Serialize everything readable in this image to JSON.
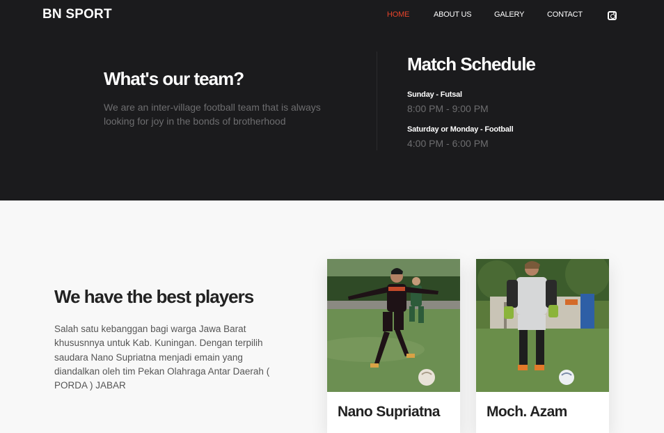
{
  "brand": "BN SPORT",
  "nav": {
    "items": [
      {
        "label": "HOME",
        "active": true
      },
      {
        "label": "ABOUT US",
        "active": false
      },
      {
        "label": "GALERY",
        "active": false
      },
      {
        "label": "CONTACT",
        "active": false
      }
    ],
    "social_icon": "instagram-icon"
  },
  "team": {
    "title": "What's our team?",
    "description": "We are an inter-village football team that is always looking for joy in the bonds of brotherhood"
  },
  "schedule": {
    "title": "Match Schedule",
    "slots": [
      {
        "label": "Sunday - Futsal",
        "time": "8:00 PM - 9:00 PM"
      },
      {
        "label": "Saturday or Monday - Football",
        "time": "4:00 PM - 6:00 PM"
      }
    ]
  },
  "players": {
    "title": "We have the best players",
    "description": "Salah satu kebanggan bagi warga Jawa Barat khususnnya untuk Kab. Kuningan. Dengan terpilih saudara Nano Supriatna menjadi emain yang diandalkan oleh tim Pekan Olahraga Antar Daerah ( PORDA ) JABAR",
    "cards": [
      {
        "name": "Nano Supriatna"
      },
      {
        "name": "Moch. Azam"
      }
    ]
  },
  "colors": {
    "header_bg": "#1b1b1d",
    "accent": "#e5432a",
    "body_bg": "#f8f8f8"
  }
}
